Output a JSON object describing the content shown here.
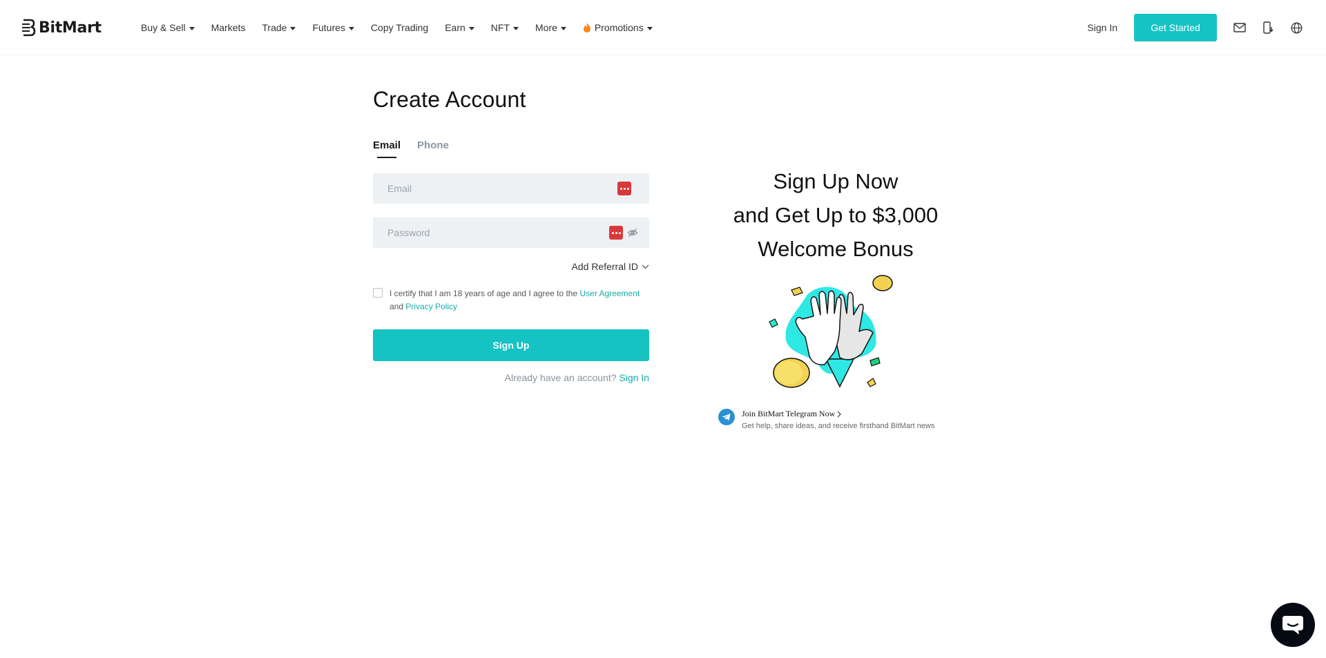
{
  "brand": {
    "name": "BitMart",
    "accent": "#16c3c3",
    "link_color": "#16a9a9"
  },
  "nav": {
    "items": [
      {
        "label": "Buy & Sell",
        "dropdown": true
      },
      {
        "label": "Markets",
        "dropdown": false
      },
      {
        "label": "Trade",
        "dropdown": true
      },
      {
        "label": "Futures",
        "dropdown": true
      },
      {
        "label": "Copy Trading",
        "dropdown": false
      },
      {
        "label": "Earn",
        "dropdown": true
      },
      {
        "label": "NFT",
        "dropdown": true
      },
      {
        "label": "More",
        "dropdown": true
      },
      {
        "label": "Promotions",
        "dropdown": true,
        "icon": "fire-icon"
      }
    ],
    "sign_in": "Sign In",
    "get_started": "Get Started",
    "icons": [
      "mail-icon",
      "mobile-download-icon",
      "globe-icon"
    ]
  },
  "form": {
    "title": "Create Account",
    "tabs": [
      {
        "label": "Email",
        "active": true
      },
      {
        "label": "Phone",
        "active": false
      }
    ],
    "email_placeholder": "Email",
    "password_placeholder": "Password",
    "referral_label": "Add Referral ID",
    "agreement": {
      "text_before": "I certify that I am 18 years of age and I agree to the ",
      "user_agreement": "User Agreement",
      "text_and": " and ",
      "privacy_policy": "Privacy Policy",
      "checked": false
    },
    "submit_label": "Sign Up",
    "already_text": "Already have an account? ",
    "sign_in_link": "Sign In"
  },
  "promo": {
    "line1": "Sign Up Now",
    "line2": "and Get Up to $3,000",
    "line3": "Welcome Bonus",
    "telegram_title": "Join BitMart Telegram Now",
    "telegram_subtitle": "Get help, share ideas, and receive firsthand BitMart news"
  },
  "chat": {
    "icon": "chat-icon"
  }
}
